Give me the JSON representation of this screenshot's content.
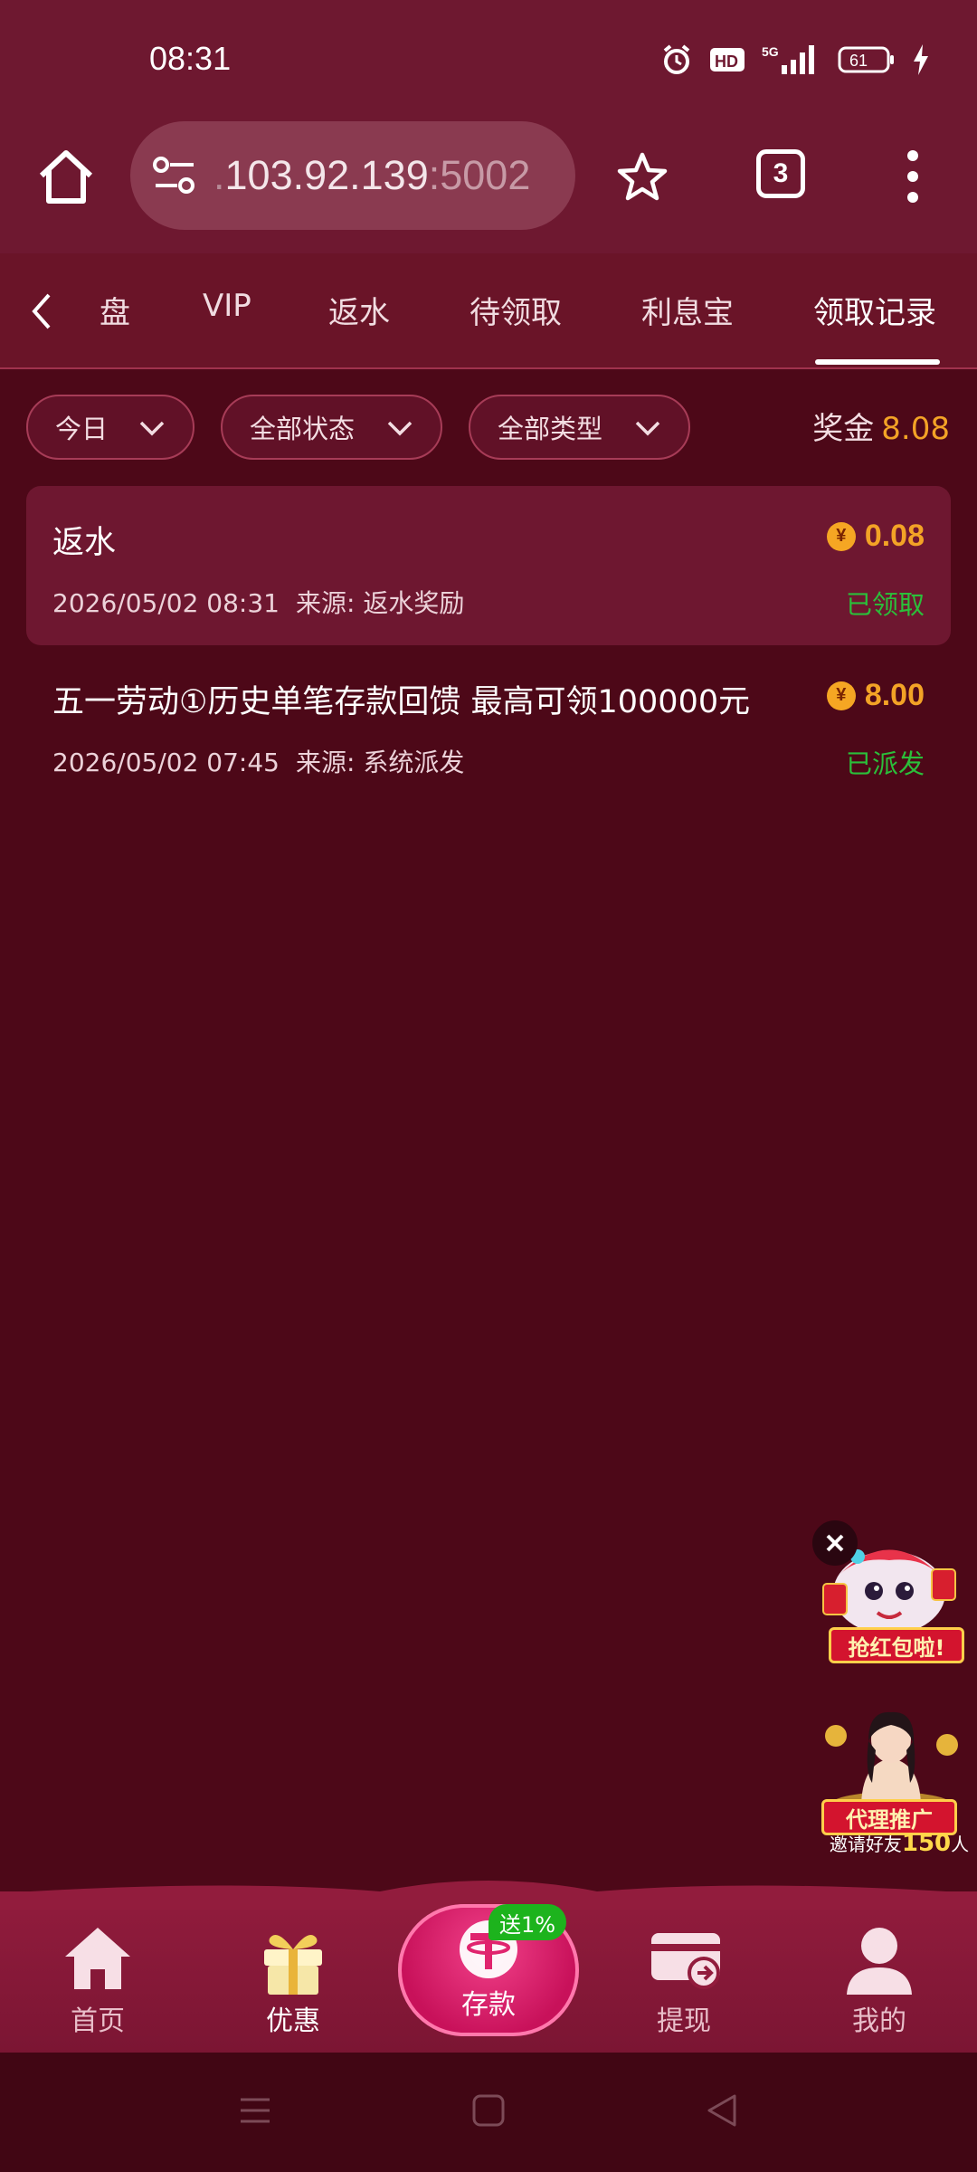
{
  "status_bar": {
    "time": "08:31",
    "icons": [
      "alarm-icon",
      "hd-icon",
      "5g-signal-icon",
      "battery-icon",
      "charging-icon"
    ],
    "battery": "61"
  },
  "browser": {
    "url_prefix": ".",
    "url_host": "103.92.139",
    "url_port": ":5002",
    "tab_count": "3"
  },
  "categories": {
    "items": [
      "盘",
      "VIP",
      "返水",
      "待领取",
      "利息宝",
      "领取记录"
    ],
    "active": "领取记录"
  },
  "filters": {
    "date": "今日",
    "status": "全部状态",
    "type": "全部类型"
  },
  "bonus": {
    "label": "奖金",
    "amount": "8.08"
  },
  "records": [
    {
      "title": "返水",
      "time": "2026/05/02 08:31",
      "source": "来源: 返水奖励",
      "amount": "0.08",
      "status": "已领取"
    },
    {
      "title": "五一劳动①历史单笔存款回馈 最高可领100000元",
      "time": "2026/05/02 07:45",
      "source": "来源: 系统派发",
      "amount": "8.00",
      "status": "已派发"
    }
  ],
  "coin_symbol": "¥",
  "promos": {
    "red_packet_label": "抢红包啦!",
    "agent_label": "代理推广",
    "agent_sub_prefix": "邀请好友",
    "agent_sub_num": "150",
    "agent_sub_suffix": "人"
  },
  "bottom_nav": {
    "home": "首页",
    "offers": "优惠",
    "deposit": "存款",
    "deposit_badge": "送1%",
    "withdraw": "提现",
    "mine": "我的"
  },
  "colors": {
    "background": "#4d0818",
    "header": "#6e1830",
    "accent_gold": "#f3a326",
    "status_green": "#2bbf3a",
    "deposit_pink": "#e0246e"
  }
}
